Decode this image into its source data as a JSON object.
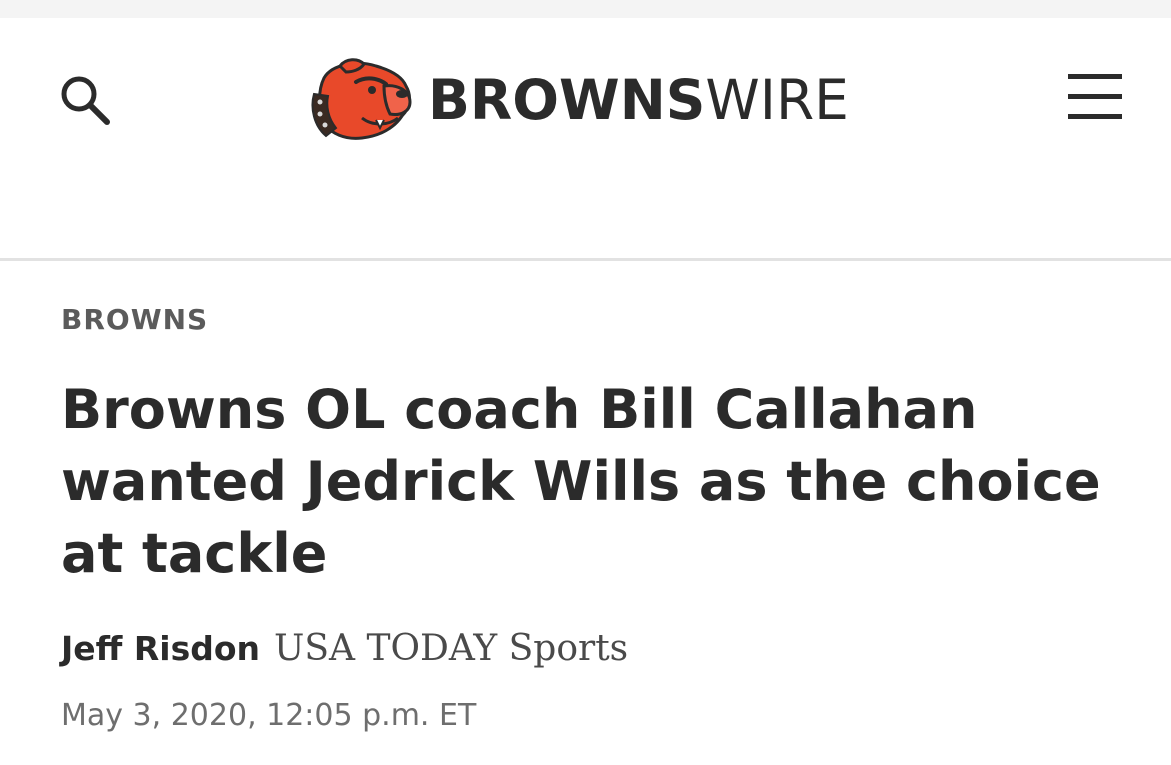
{
  "header": {
    "logo_bold": "BROWNS",
    "logo_light": "WIRE",
    "search_icon": "search-icon",
    "menu_icon": "hamburger-menu-icon",
    "logo_icon": "bulldog-mascot-icon"
  },
  "article": {
    "category": "BROWNS",
    "headline": "Browns OL coach Bill Callahan wanted Jedrick Wills as the choice at tackle",
    "author": "Jeff Risdon",
    "source": "USA TODAY Sports",
    "date": "May 3, 2020, 12:05 p.m. ET"
  },
  "colors": {
    "brand_orange": "#e8492a",
    "text_dark": "#2b2b2b",
    "text_muted": "#6e6e6e"
  }
}
